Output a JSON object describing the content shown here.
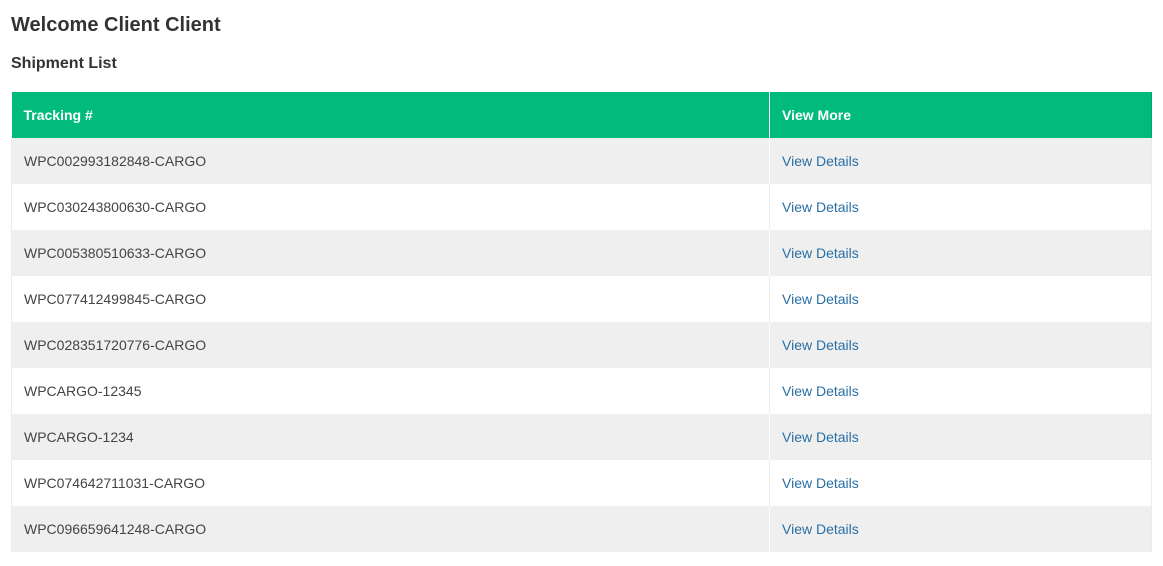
{
  "header": {
    "welcome": "Welcome Client Client",
    "subtitle": "Shipment List"
  },
  "table": {
    "columns": [
      "Tracking #",
      "View More"
    ],
    "rows": [
      {
        "tracking": "WPC002993182848-CARGO",
        "action": "View Details"
      },
      {
        "tracking": "WPC030243800630-CARGO",
        "action": "View Details"
      },
      {
        "tracking": "WPC005380510633-CARGO",
        "action": "View Details"
      },
      {
        "tracking": "WPC077412499845-CARGO",
        "action": "View Details"
      },
      {
        "tracking": "WPC028351720776-CARGO",
        "action": "View Details"
      },
      {
        "tracking": "WPCARGO-12345",
        "action": "View Details"
      },
      {
        "tracking": "WPCARGO-1234",
        "action": "View Details"
      },
      {
        "tracking": "WPC074642711031-CARGO",
        "action": "View Details"
      },
      {
        "tracking": "WPC096659641248-CARGO",
        "action": "View Details"
      }
    ]
  },
  "colors": {
    "header_bg": "#00bb7c",
    "link": "#2a6fa3",
    "row_alt": "#efefef"
  }
}
